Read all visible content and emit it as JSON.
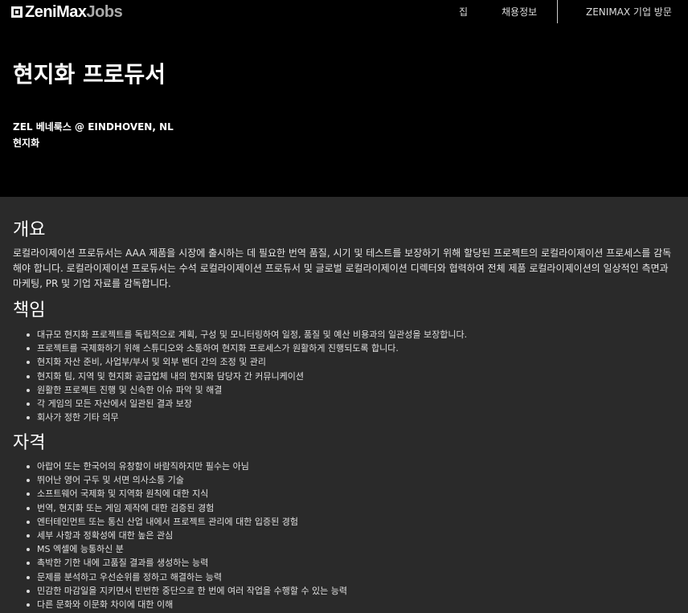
{
  "header": {
    "logo_word": "ZeniMax",
    "logo_jobs": "Jobs",
    "nav": {
      "home": "집",
      "jobs": "채용정보",
      "visit": "ZENIMAX 기업 방문"
    }
  },
  "hero": {
    "title": "현지화 프로듀서",
    "company_location": "ZEL 베네룩스 @ EINDHOVEN, NL",
    "department": "현지화"
  },
  "overview": {
    "heading": "개요",
    "text": "로컬라이제이션 프로듀서는 AAA 제품을 시장에 출시하는 데 필요한 번역 품질, 시기 및 테스트를 보장하기 위해 할당된 프로젝트의 로컬라이제이션 프로세스를 감독해야 합니다. 로컬라이제이션 프로듀서는 수석 로컬라이제이션 프로듀서 및 글로벌 로컬라이제이션 디렉터와 협력하여 전체 제품 로컬라이제이션의 일상적인 측면과 마케팅, PR 및 기업 자료를 감독합니다."
  },
  "responsibilities": {
    "heading": "책임",
    "items": [
      "대규모 현지화 프로젝트를 독립적으로 계획, 구성 및 모니터링하여 일정, 품질 및 예산 비용과의 일관성을 보장합니다.",
      "프로젝트를 국제화하기 위해 스튜디오와 소통하여 현지화 프로세스가 원활하게 진행되도록 합니다.",
      "현지화 자산 준비, 사업부/부서 및 외부 벤더 간의 조정 및 관리",
      "현지화 팀, 지역 및 현지화 공급업체 내의 현지화 담당자 간 커뮤니케이션",
      "원활한 프로젝트 진행 및 신속한 이슈 파악 및 해결",
      "각 게임의 모든 자산에서 일관된 결과 보장",
      "회사가 정한 기타 의무"
    ]
  },
  "qualifications": {
    "heading": "자격",
    "items": [
      "아랍어 또는 한국어의 유창함이 바람직하지만 필수는 아님",
      "뛰어난 영어 구두 및 서면 의사소통 기술",
      "소프트웨어 국제화 및 지역화 원칙에 대한 지식",
      "번역, 현지화 또는 게임 제작에 대한 검증된 경험",
      "엔터테인먼트 또는 통신 산업 내에서 프로젝트 관리에 대한 입증된 경험",
      "세부 사항과 정확성에 대한 높은 관심",
      "MS 엑셀에 능통하신 분",
      "촉박한 기한 내에 고품질 결과를 생성하는 능력",
      "문제를 분석하고 우선순위를 정하고 해결하는 능력",
      "민감한 마감일을 지키면서 빈번한 중단으로 한 번에 여러 작업을 수행할 수 있는 능력",
      "다른 문화와 이문화 차이에 대한 이해"
    ]
  }
}
